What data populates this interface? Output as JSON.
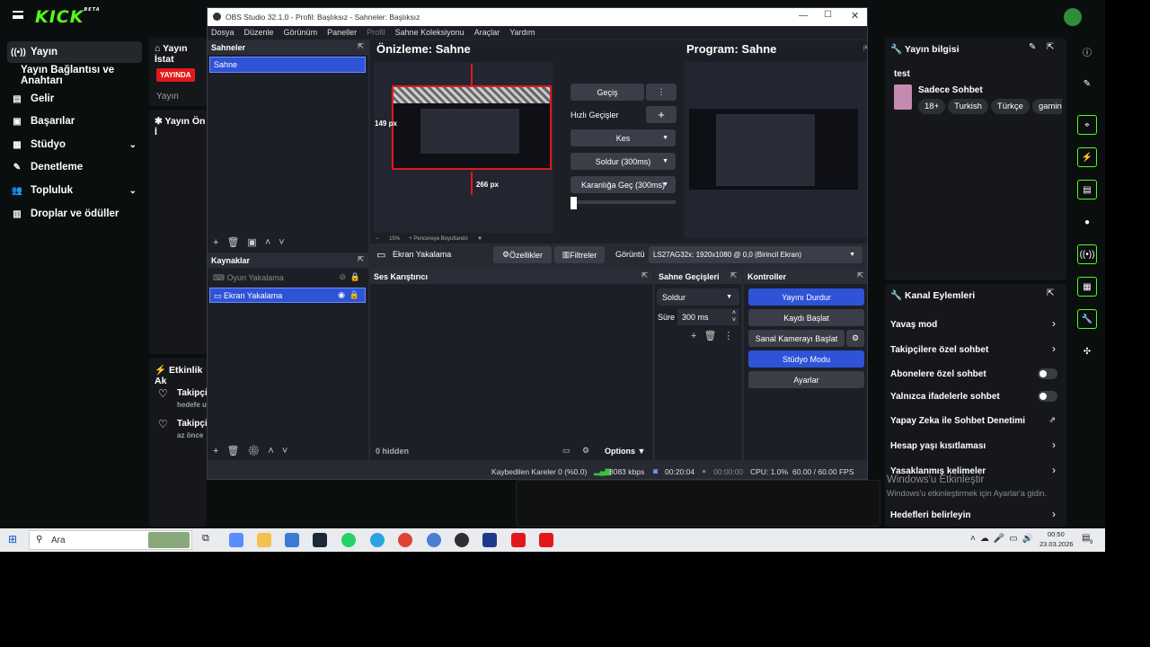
{
  "kick": {
    "logo": "KICK",
    "logo_sup": "BETA",
    "nav": [
      {
        "label": "Yayın",
        "icon": "broadcast-icon",
        "active": true
      },
      {
        "label": "Yayın Bağlantısı ve Anahtarı",
        "icon": "",
        "active": false
      },
      {
        "label": "Gelir",
        "icon": "income-icon",
        "active": false
      },
      {
        "label": "Başarılar",
        "icon": "achievements-icon",
        "active": false
      },
      {
        "label": "Stüdyo",
        "icon": "studio-icon",
        "active": false,
        "expandable": true
      },
      {
        "label": "Denetleme",
        "icon": "moderation-icon",
        "active": false
      },
      {
        "label": "Topluluk",
        "icon": "community-icon",
        "active": false,
        "expandable": true
      },
      {
        "label": "Droplar ve ödüller",
        "icon": "drops-icon",
        "active": false
      }
    ],
    "stream_stats": {
      "title": "Yayın İstat",
      "live_badge": "YAYINDA",
      "sub": "Yayın"
    },
    "preview_panel": {
      "title": "Yayın Ön İ"
    },
    "activity": {
      "title": "Etkinlik Ak",
      "items": [
        {
          "title": "Takipçi",
          "sub": "hedefe u"
        },
        {
          "title": "Takipçi",
          "sub": "az önce"
        }
      ]
    },
    "stream_info": {
      "title": "Yayın bilgisi",
      "stream_title": "test",
      "category": "Sadece Sohbet",
      "tags": [
        "18+",
        "Turkish",
        "Türkçe",
        "gaming"
      ]
    },
    "channel_actions": {
      "title": "Kanal Eylemleri",
      "items": [
        {
          "label": "Yavaş mod",
          "control": "chevron"
        },
        {
          "label": "Takipçilere özel sohbet",
          "control": "chevron"
        },
        {
          "label": "Abonelere özel sohbet",
          "control": "toggle"
        },
        {
          "label": "Yalnızca ifadelerle sohbet",
          "control": "toggle"
        },
        {
          "label": "Yapay Zeka ile Sohbet Denetimi",
          "control": "external"
        },
        {
          "label": "Hesap yaşı kısıtlaması",
          "control": "chevron"
        },
        {
          "label": "Yasaklanmış kelimeler",
          "control": "chevron"
        },
        {
          "label": "Hedefleri belirleyin",
          "control": "chevron"
        }
      ]
    },
    "windows_activation": {
      "line1": "Windows'u Etkinleştir",
      "line2": "Windows'u etkinleştirmek için Ayarlar'a gidin."
    }
  },
  "obs": {
    "title": "OBS Studio 32.1.0 - Profil: Başlıksız - Sahneler: Başlıksız",
    "menu": [
      "Dosya",
      "Düzenle",
      "Görünüm",
      "Paneller",
      "Profil",
      "Sahne Koleksiyonu",
      "Araçlar",
      "Yardım"
    ],
    "scenes": {
      "title": "Sahneler",
      "items": [
        "Sahne"
      ]
    },
    "sources": {
      "title": "Kaynaklar",
      "items": [
        {
          "label": "Oyun Yakalama",
          "visible": false
        },
        {
          "label": "Ekran Yakalama",
          "visible": true
        }
      ]
    },
    "preview": {
      "title": "Önizleme: Sahne",
      "dim_h": "149 px",
      "dim_v": "266 px",
      "zoom": "15%",
      "fit_label": "Pencereye Boyutlandır"
    },
    "program": {
      "title": "Program: Sahne"
    },
    "transitions": {
      "gecis": "Geçiş",
      "quick_label": "Hızlı Geçişler",
      "kes": "Kes",
      "fade": "Soldur (300ms)",
      "fade_black": "Karanlığa Geç (300ms)"
    },
    "source_bar": {
      "name": "Ekran Yakalama",
      "props": "Özellikler",
      "filters": "Filtreler",
      "display_label": "Görüntü",
      "display_value": "LS27AG32x: 1920x1080 @ 0,0 (Birincil Ekran)"
    },
    "mixer": {
      "title": "Ses Karıştırıcı",
      "hidden": "0 hidden",
      "options": "Options"
    },
    "scene_transitions": {
      "title": "Sahne Geçişleri",
      "type": "Soldur",
      "duration_label": "Süre",
      "duration_value": "300 ms"
    },
    "controls": {
      "title": "Kontroller",
      "buttons": [
        "Yayını Durdur",
        "Kaydı Başlat",
        "Sanal Kamerayı Başlat",
        "Stüdyo Modu",
        "Ayarlar"
      ]
    },
    "status": {
      "dropped": "Kaybedilen Kareler 0 (%0.0)",
      "bitrate": "8083 kbps",
      "live_time": "00:20:04",
      "rec_time": "00:00:00",
      "cpu": "CPU: 1.0%",
      "fps": "60.00 / 60.00 FPS"
    }
  },
  "taskbar": {
    "search": "Ara",
    "time": "00:50",
    "date": "23.03.2026",
    "notif_count": "9"
  },
  "colors": {
    "kick_green": "#53fc18",
    "obs_blue": "#2f53d6",
    "live_red": "#e3181c"
  }
}
